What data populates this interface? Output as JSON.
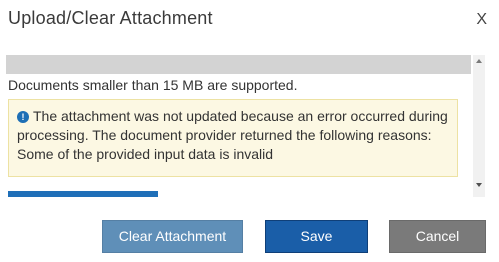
{
  "dialog": {
    "title": "Upload/Clear Attachment",
    "close_label": "X"
  },
  "content": {
    "info_text": "Documents smaller than 15 MB are supported.",
    "alert_icon": "info-icon",
    "alert_icon_glyph": "!",
    "alert_message": "The attachment was not updated because an error occurred during processing. The document provider returned the following reasons: Some of the provided input data is invalid"
  },
  "buttons": {
    "clear_label": "Clear Attachment",
    "save_label": "Save",
    "cancel_label": "Cancel"
  },
  "colors": {
    "alert_background": "#fcf8e3",
    "primary": "#1a5ea8",
    "secondary": "#5f8fb8",
    "neutral": "#7a7a7a"
  }
}
